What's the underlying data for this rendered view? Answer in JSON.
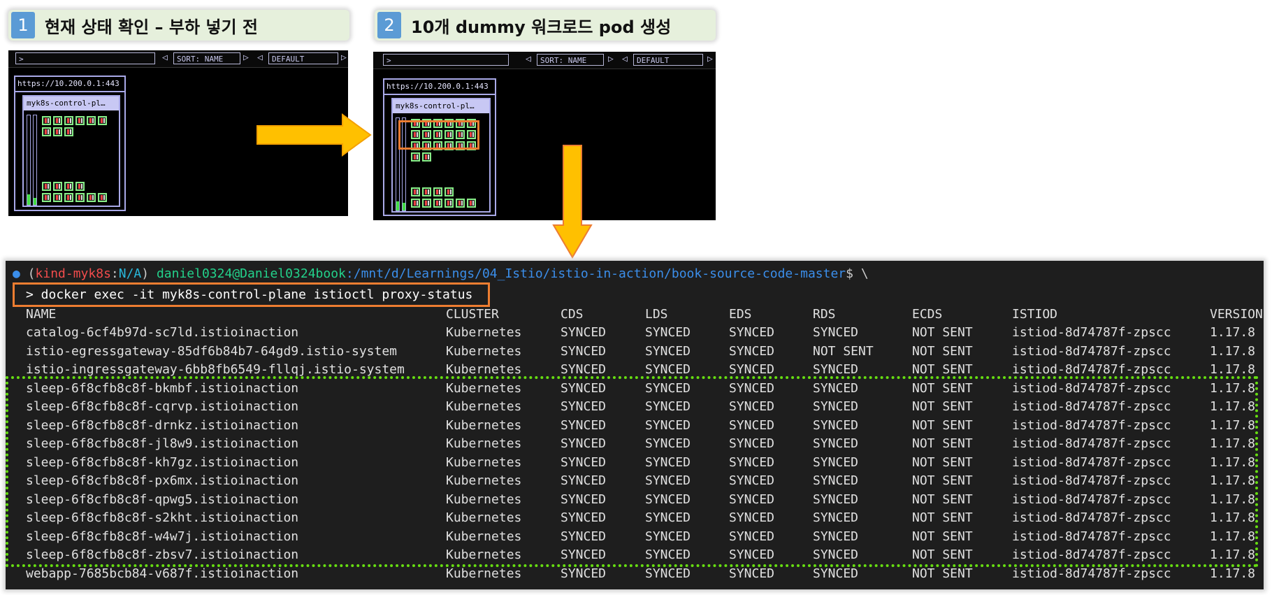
{
  "steps": [
    {
      "number": "1",
      "label": "현재 상태 확인 – 부하 넣기 전"
    },
    {
      "number": "2",
      "label": "10개 dummy 워크로드 pod 생성"
    }
  ],
  "kube_panels": [
    {
      "search_prompt": ">",
      "sort_label": "SORT: NAME",
      "filter_label": "DEFAULT",
      "server_url": "https://10.200.0.1:443",
      "node_name": "myk8s-control-pl…"
    },
    {
      "search_prompt": ">",
      "sort_label": "SORT: NAME",
      "filter_label": "DEFAULT",
      "server_url": "https://10.200.0.1:443",
      "node_name": "myk8s-control-pl…"
    }
  ],
  "terminal": {
    "prompt": {
      "context": "kind-myk8s",
      "namespace": "N/A",
      "user_host": "daniel0324@Daniel0324book",
      "path": ":/mnt/d/Learnings/04_Istio/istio-in-action/book-source-code-master",
      "suffix": "$ \\"
    },
    "command": "> docker exec -it myk8s-control-plane istioctl proxy-status",
    "headers": [
      "NAME",
      "CLUSTER",
      "CDS",
      "LDS",
      "EDS",
      "RDS",
      "ECDS",
      "ISTIOD",
      "VERSION"
    ],
    "rows": [
      [
        "catalog-6cf4b97d-sc7ld.istioinaction",
        "Kubernetes",
        "SYNCED",
        "SYNCED",
        "SYNCED",
        "SYNCED",
        "NOT SENT",
        "istiod-8d74787f-zpscc",
        "1.17.8"
      ],
      [
        "istio-egressgateway-85df6b84b7-64gd9.istio-system",
        "Kubernetes",
        "SYNCED",
        "SYNCED",
        "SYNCED",
        "NOT SENT",
        "NOT SENT",
        "istiod-8d74787f-zpscc",
        "1.17.8"
      ],
      [
        "istio-ingressgateway-6bb8fb6549-fllqj.istio-system",
        "Kubernetes",
        "SYNCED",
        "SYNCED",
        "SYNCED",
        "SYNCED",
        "NOT SENT",
        "istiod-8d74787f-zpscc",
        "1.17.8"
      ],
      [
        "sleep-6f8cfb8c8f-bkmbf.istioinaction",
        "Kubernetes",
        "SYNCED",
        "SYNCED",
        "SYNCED",
        "SYNCED",
        "NOT SENT",
        "istiod-8d74787f-zpscc",
        "1.17.8"
      ],
      [
        "sleep-6f8cfb8c8f-cqrvp.istioinaction",
        "Kubernetes",
        "SYNCED",
        "SYNCED",
        "SYNCED",
        "SYNCED",
        "NOT SENT",
        "istiod-8d74787f-zpscc",
        "1.17.8"
      ],
      [
        "sleep-6f8cfb8c8f-drnkz.istioinaction",
        "Kubernetes",
        "SYNCED",
        "SYNCED",
        "SYNCED",
        "SYNCED",
        "NOT SENT",
        "istiod-8d74787f-zpscc",
        "1.17.8"
      ],
      [
        "sleep-6f8cfb8c8f-jl8w9.istioinaction",
        "Kubernetes",
        "SYNCED",
        "SYNCED",
        "SYNCED",
        "SYNCED",
        "NOT SENT",
        "istiod-8d74787f-zpscc",
        "1.17.8"
      ],
      [
        "sleep-6f8cfb8c8f-kh7gz.istioinaction",
        "Kubernetes",
        "SYNCED",
        "SYNCED",
        "SYNCED",
        "SYNCED",
        "NOT SENT",
        "istiod-8d74787f-zpscc",
        "1.17.8"
      ],
      [
        "sleep-6f8cfb8c8f-px6mx.istioinaction",
        "Kubernetes",
        "SYNCED",
        "SYNCED",
        "SYNCED",
        "SYNCED",
        "NOT SENT",
        "istiod-8d74787f-zpscc",
        "1.17.8"
      ],
      [
        "sleep-6f8cfb8c8f-qpwg5.istioinaction",
        "Kubernetes",
        "SYNCED",
        "SYNCED",
        "SYNCED",
        "SYNCED",
        "NOT SENT",
        "istiod-8d74787f-zpscc",
        "1.17.8"
      ],
      [
        "sleep-6f8cfb8c8f-s2kht.istioinaction",
        "Kubernetes",
        "SYNCED",
        "SYNCED",
        "SYNCED",
        "SYNCED",
        "NOT SENT",
        "istiod-8d74787f-zpscc",
        "1.17.8"
      ],
      [
        "sleep-6f8cfb8c8f-w4w7j.istioinaction",
        "Kubernetes",
        "SYNCED",
        "SYNCED",
        "SYNCED",
        "SYNCED",
        "NOT SENT",
        "istiod-8d74787f-zpscc",
        "1.17.8"
      ],
      [
        "sleep-6f8cfb8c8f-zbsv7.istioinaction",
        "Kubernetes",
        "SYNCED",
        "SYNCED",
        "SYNCED",
        "SYNCED",
        "NOT SENT",
        "istiod-8d74787f-zpscc",
        "1.17.8"
      ],
      [
        "webapp-7685bcb84-v687f.istioinaction",
        "Kubernetes",
        "SYNCED",
        "SYNCED",
        "SYNCED",
        "SYNCED",
        "NOT SENT",
        "istiod-8d74787f-zpscc",
        "1.17.8"
      ]
    ]
  },
  "colors": {
    "step_badge": "#5b9bd5",
    "step_bg": "#e6f0dc",
    "arrow": "#ffc000",
    "highlight_orange": "#ed7d31",
    "highlight_green": "#66dd11",
    "terminal_bg": "#1e1e1e",
    "prompt_context": "#f14c4c",
    "prompt_namespace": "#29b8db",
    "prompt_user": "#23d18b",
    "prompt_path": "#3b8eea"
  },
  "icons": {
    "flow_arrow_right": "block-arrow-right",
    "flow_arrow_down": "block-arrow-down",
    "prompt_dot": "circle-icon"
  }
}
